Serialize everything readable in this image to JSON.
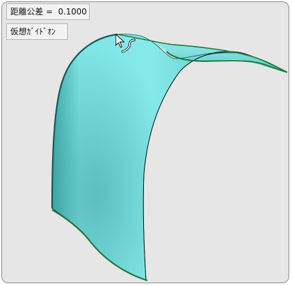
{
  "viewport": {
    "tolerance_label": "距離公差 =",
    "tolerance_value": "0.1000",
    "virtual_guide_label": "仮想ｶﾞｲﾄﾞｵﾝ"
  },
  "colors": {
    "surface": "#7fe6e6",
    "surface_shadow": "#3fa8a8",
    "edge_green": "#1a7a3a",
    "background": "#e6e6e6"
  },
  "icons": {
    "cursor": "arrow-cursor-with-curve-icon"
  }
}
